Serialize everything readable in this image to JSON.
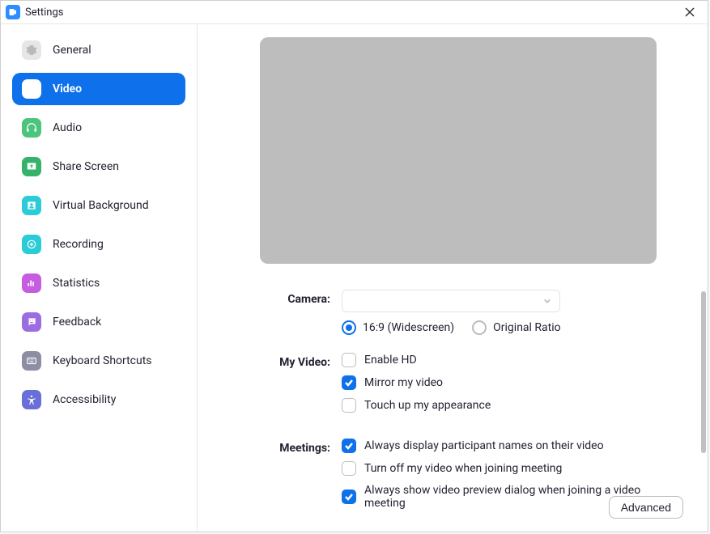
{
  "window": {
    "title": "Settings"
  },
  "sidebar": {
    "items": [
      {
        "label": "General"
      },
      {
        "label": "Video"
      },
      {
        "label": "Audio"
      },
      {
        "label": "Share Screen"
      },
      {
        "label": "Virtual Background"
      },
      {
        "label": "Recording"
      },
      {
        "label": "Statistics"
      },
      {
        "label": "Feedback"
      },
      {
        "label": "Keyboard Shortcuts"
      },
      {
        "label": "Accessibility"
      }
    ]
  },
  "video": {
    "camera_label": "Camera:",
    "camera_value": "",
    "ratio": {
      "wide": "16:9 (Widescreen)",
      "orig": "Original Ratio"
    },
    "myvideo_label": "My Video:",
    "myvideo": {
      "enable_hd": "Enable HD",
      "mirror": "Mirror my video",
      "touchup": "Touch up my appearance"
    },
    "meetings_label": "Meetings:",
    "meetings": {
      "display_names": "Always display participant names on their video",
      "turn_off_join": "Turn off my video when joining meeting",
      "preview_join": "Always show video preview dialog when joining a video meeting"
    }
  },
  "footer": {
    "advanced": "Advanced"
  }
}
